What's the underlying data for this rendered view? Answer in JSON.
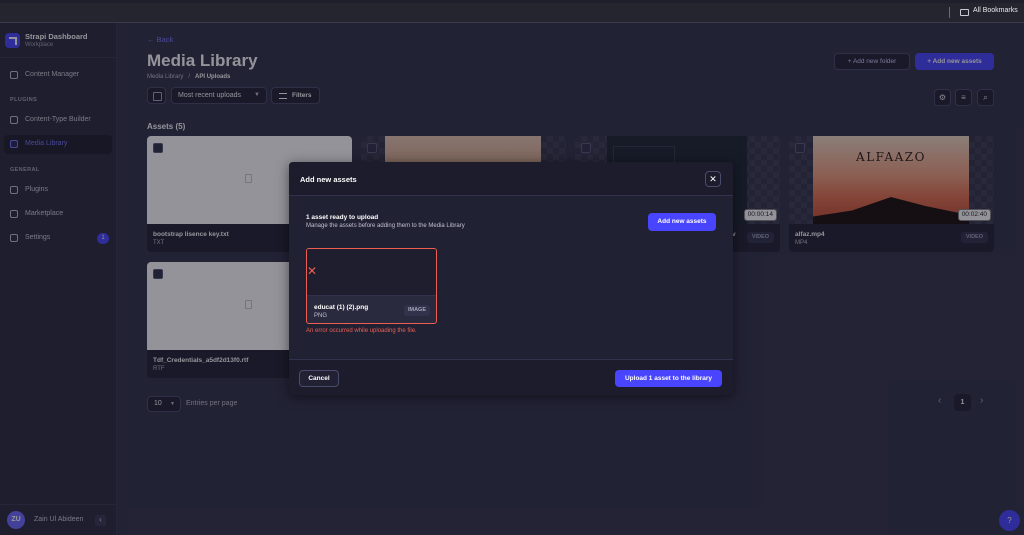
{
  "browser": {
    "bookmarks_label": "All Bookmarks"
  },
  "sidebar": {
    "brand_title": "Strapi Dashboard",
    "brand_subtitle": "Workplace",
    "items": [
      {
        "label": "Content Manager",
        "icon": "feather-icon"
      },
      {
        "label": "Content-Type Builder",
        "icon": "layout-icon"
      },
      {
        "label": "Media Library",
        "icon": "image-icon"
      },
      {
        "label": "Plugins",
        "icon": "puzzle-icon"
      },
      {
        "label": "Marketplace",
        "icon": "cart-icon"
      },
      {
        "label": "Settings",
        "icon": "gear-icon"
      }
    ],
    "sections": {
      "plugins": "PLUGINS",
      "general": "GENERAL"
    },
    "settings_badge": "1",
    "user": {
      "initials": "ZU",
      "name": "Zain Ul Abideen",
      "collapse_icon": "‹"
    }
  },
  "header": {
    "back_label": "Back",
    "title": "Media Library",
    "breadcrumb": {
      "root": "Media Library",
      "separator": "/",
      "current": "API Uploads"
    },
    "add_folder_label": "Add new folder",
    "add_assets_label": "Add new assets"
  },
  "toolbar": {
    "sort_value": "Most recent uploads",
    "filters_label": "Filters",
    "settings_icon": "⚙",
    "list_icon": "≡",
    "search_icon": "⌕"
  },
  "assets": {
    "heading": "Assets (5)",
    "items": [
      {
        "name": "bootstrap lisence key.txt",
        "ext": "TXT"
      },
      {
        "name": "alfaz.mp4",
        "ext": "MP4",
        "tag": "VIDEO",
        "duration": "00:02:40",
        "thumb_text": "ALFAAZO"
      },
      {
        "name": "Tdf_Credentials_a5df2d13f0.rtf",
        "ext": "RTF"
      },
      {
        "tag": "VIDEO",
        "duration": "00:00:14",
        "name_fragment": "v"
      }
    ]
  },
  "pagination": {
    "rows_value": "10",
    "rows_label": "Entries per page",
    "current_page": "1",
    "prev_icon": "‹",
    "next_icon": "›"
  },
  "help": {
    "label": "?"
  },
  "modal": {
    "title": "Add new assets",
    "close_icon": "✕",
    "ready_title": "1 asset ready to upload",
    "ready_subtitle": "Manage the assets before adding them to the Media Library",
    "add_button": "Add new assets",
    "upload_item": {
      "name": "educat (1) (2).png",
      "ext": "PNG",
      "tag": "IMAGE",
      "error_icon": "✕"
    },
    "error_message": "An error occurred while uploading the file.",
    "cancel_label": "Cancel",
    "upload_label": "Upload 1 asset to the library"
  },
  "colors": {
    "accent": "#4945ff",
    "error": "#ee5e52",
    "background": "#32324a",
    "surface": "#212134"
  }
}
